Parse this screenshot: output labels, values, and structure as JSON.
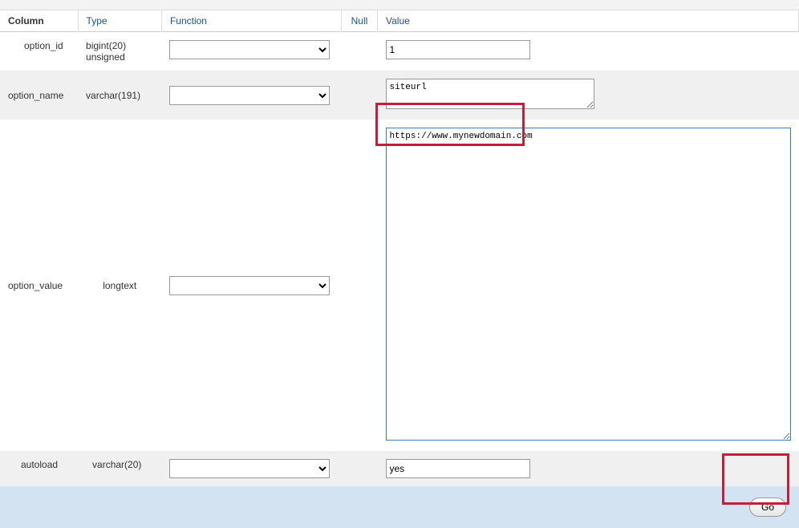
{
  "headers": {
    "column": "Column",
    "type": "Type",
    "function": "Function",
    "null": "Null",
    "value": "Value"
  },
  "rows": [
    {
      "column": "option_id",
      "type": "bigint(20) unsigned",
      "value": "1"
    },
    {
      "column": "option_name",
      "type": "varchar(191)",
      "value": "siteurl"
    },
    {
      "column": "option_value",
      "type": "longtext",
      "value": "https://www.mynewdomain.com"
    },
    {
      "column": "autoload",
      "type": "varchar(20)",
      "value": "yes"
    }
  ],
  "buttons": {
    "go": "Go"
  }
}
